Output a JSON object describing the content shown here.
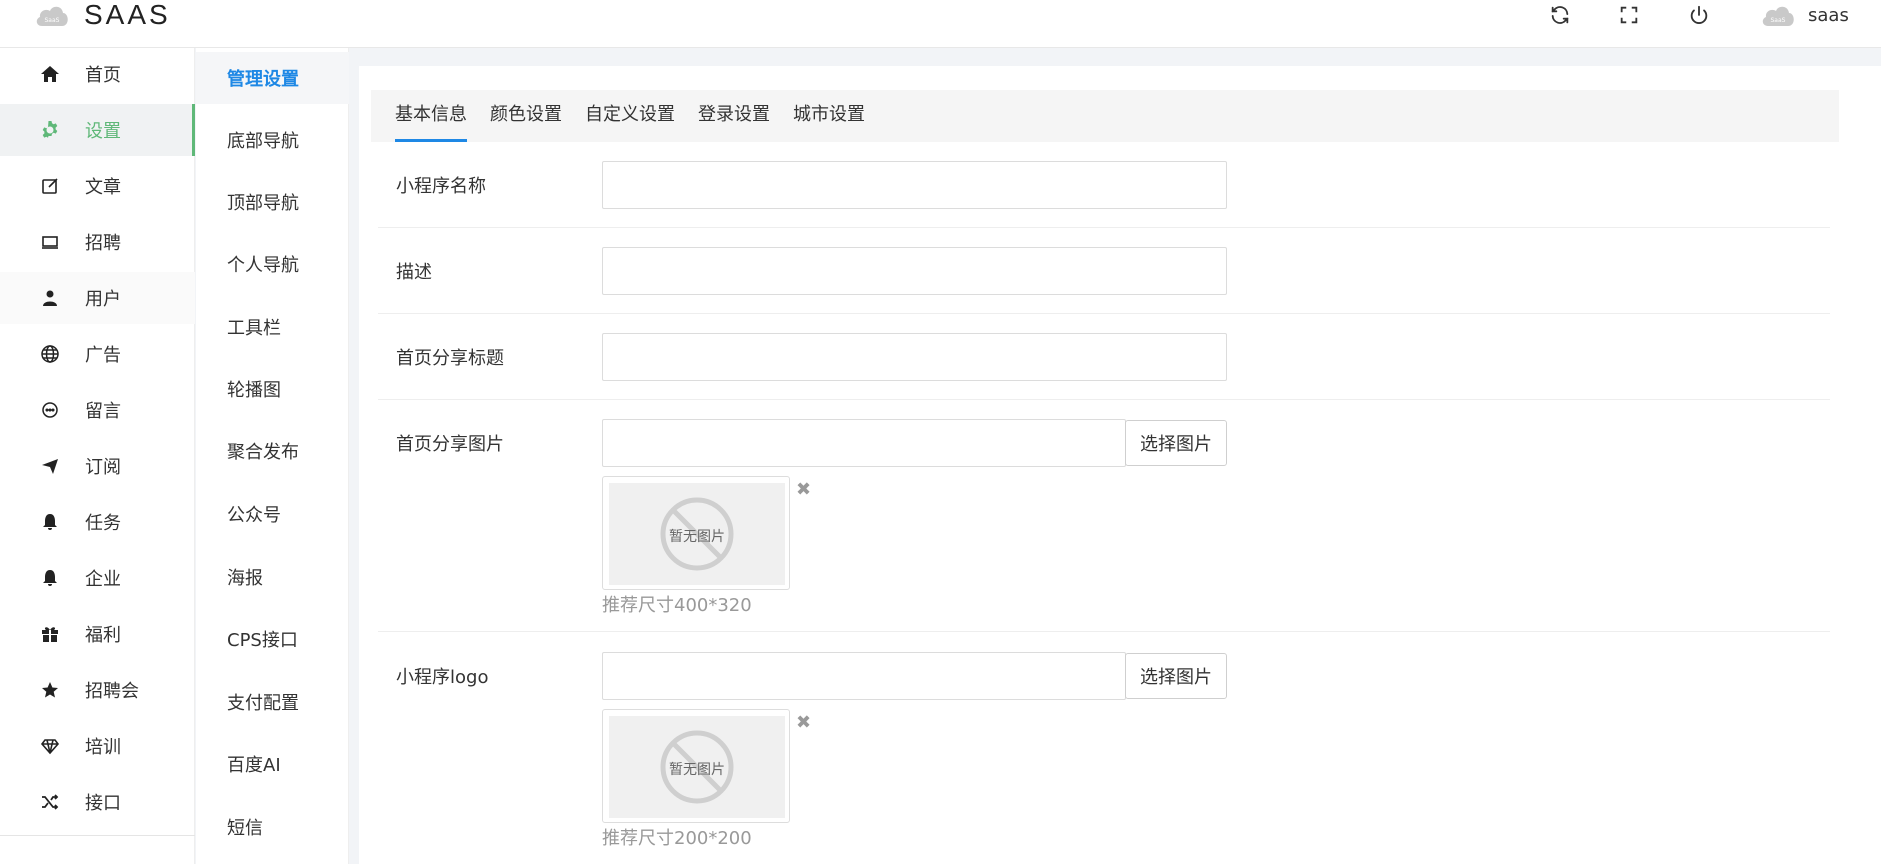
{
  "header": {
    "logo_badge": "SaaS",
    "app_title": "SAAS",
    "icons": [
      "refresh-icon",
      "fullscreen-icon",
      "power-icon"
    ],
    "user_badge": "SaaS",
    "username": "saas"
  },
  "sidebar": {
    "items": [
      {
        "label": "首页",
        "icon": "home-icon"
      },
      {
        "label": "设置",
        "icon": "gear-icon",
        "active": true
      },
      {
        "label": "文章",
        "icon": "edit-icon"
      },
      {
        "label": "招聘",
        "icon": "monitor-icon"
      },
      {
        "label": "用户",
        "icon": "user-icon"
      },
      {
        "label": "广告",
        "icon": "globe-icon"
      },
      {
        "label": "留言",
        "icon": "chat-icon"
      },
      {
        "label": "订阅",
        "icon": "send-icon"
      },
      {
        "label": "任务",
        "icon": "bell-icon"
      },
      {
        "label": "企业",
        "icon": "bell-icon"
      },
      {
        "label": "福利",
        "icon": "gift-icon"
      },
      {
        "label": "招聘会",
        "icon": "star-icon"
      },
      {
        "label": "培训",
        "icon": "diamond-icon"
      },
      {
        "label": "接口",
        "icon": "shuffle-icon"
      }
    ]
  },
  "subnav": {
    "items": [
      {
        "label": "管理设置",
        "active": true
      },
      {
        "label": "底部导航"
      },
      {
        "label": "顶部导航"
      },
      {
        "label": "个人导航"
      },
      {
        "label": "工具栏"
      },
      {
        "label": "轮播图"
      },
      {
        "label": "聚合发布"
      },
      {
        "label": "公众号"
      },
      {
        "label": "海报"
      },
      {
        "label": "CPS接口"
      },
      {
        "label": "支付配置"
      },
      {
        "label": "百度AI"
      },
      {
        "label": "短信"
      }
    ]
  },
  "tabs": [
    {
      "label": "基本信息",
      "active": true
    },
    {
      "label": "颜色设置"
    },
    {
      "label": "自定义设置"
    },
    {
      "label": "登录设置"
    },
    {
      "label": "城市设置"
    }
  ],
  "form": {
    "mini_name": {
      "label": "小程序名称",
      "value": ""
    },
    "description": {
      "label": "描述",
      "value": ""
    },
    "share_title": {
      "label": "首页分享标题",
      "value": ""
    },
    "share_image": {
      "label": "首页分享图片",
      "value": "",
      "button": "选择图片",
      "placeholder_image_text": "暂无图片",
      "hint": "推荐尺寸400*320",
      "delete_symbol": "✖"
    },
    "logo": {
      "label": "小程序logo",
      "value": "",
      "button": "选择图片",
      "placeholder_image_text": "暂无图片",
      "hint": "推荐尺寸200*200",
      "delete_symbol": "✖"
    }
  },
  "colors": {
    "accent_green": "#5fb878",
    "accent_blue": "#1e88e5"
  }
}
